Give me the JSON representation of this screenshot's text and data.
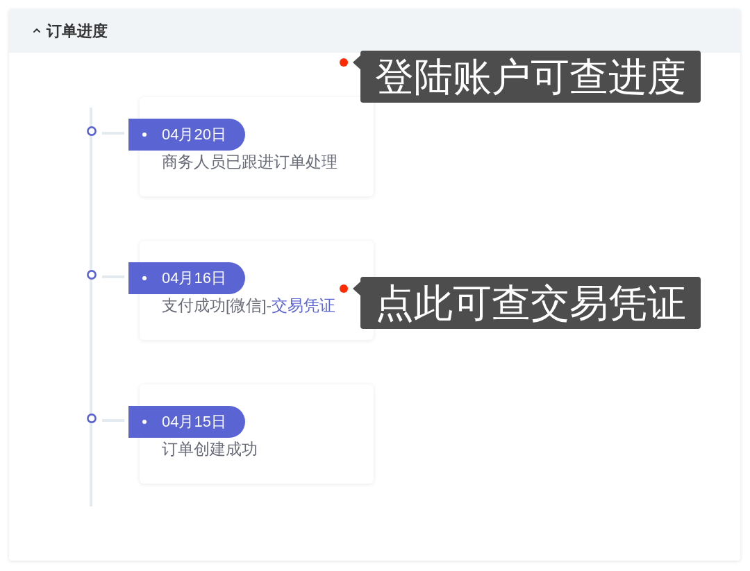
{
  "panel": {
    "title": "订单进度",
    "expanded": true,
    "annotation": {
      "text": "登陆账户可查进度"
    },
    "timeline": [
      {
        "date": "04月20日",
        "description": "商务人员已跟进订单处理"
      },
      {
        "date": "04月16日",
        "description": "支付成功[微信]-",
        "link": "交易凭证",
        "annotation": {
          "text": "点此可查交易凭证"
        }
      },
      {
        "date": "04月15日",
        "description": "订单创建成功"
      }
    ]
  }
}
